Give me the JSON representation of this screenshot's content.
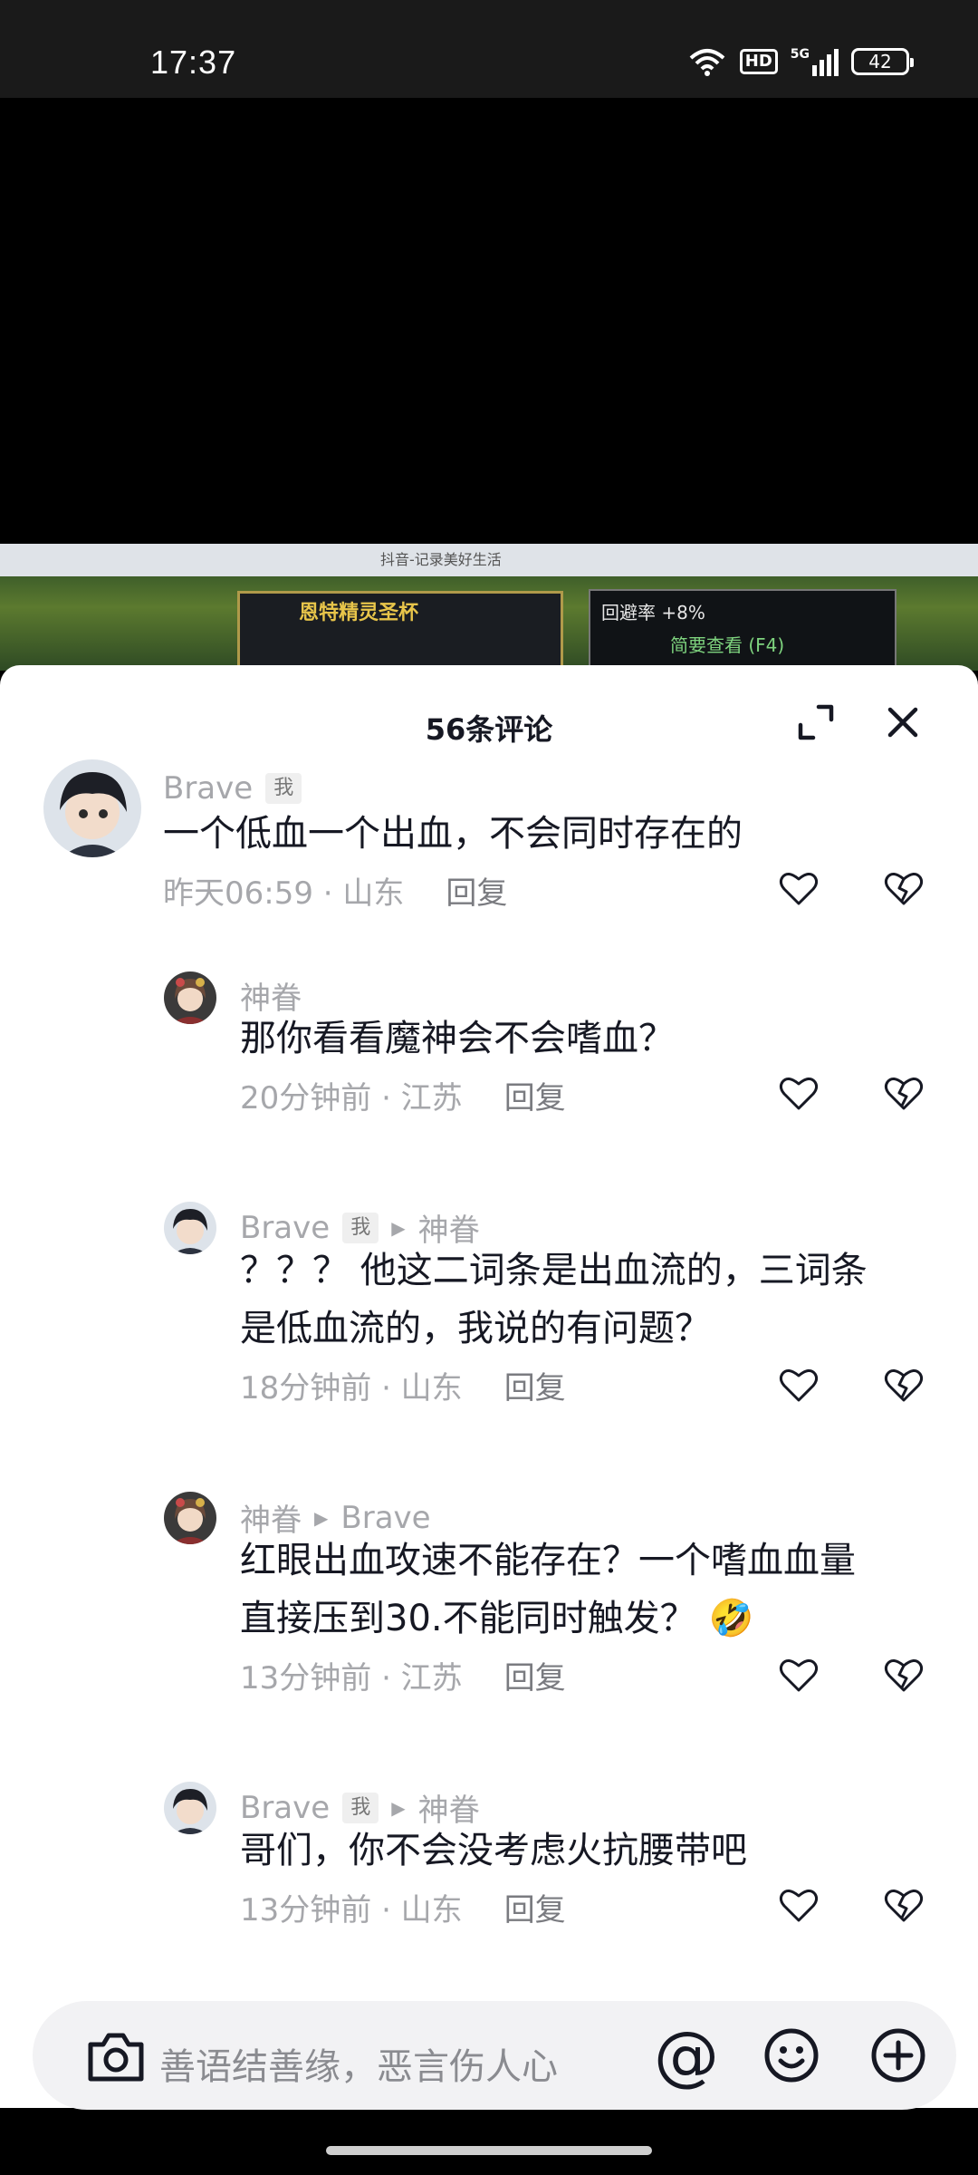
{
  "status": {
    "time": "17:37",
    "network": "5G",
    "hd": "HD",
    "battery": "42"
  },
  "video": {
    "tab_text": "抖音-记录美好生活",
    "game_title": "恩特精灵圣杯",
    "game_stat": "回避率 +8%",
    "game_link": "简要查看 (F4)"
  },
  "sheet": {
    "title": "56条评论"
  },
  "comments": [
    {
      "name": "Brave",
      "badge": "我",
      "text": "一个低血一个出血，不会同时存在的",
      "time_loc": "昨天06:59 · 山东",
      "reply": "回复"
    },
    {
      "name": "神眷",
      "text": "那你看看魔神会不会嗜血？",
      "time_loc": "20分钟前 · 江苏",
      "reply": "回复"
    },
    {
      "name": "Brave",
      "badge": "我",
      "reply_to": "神眷",
      "text_lines": [
        "？？？ 他这二词条是出血流的，三词条",
        "是低血流的，我说的有问题？"
      ],
      "time_loc": "18分钟前 · 山东",
      "reply": "回复"
    },
    {
      "name": "神眷",
      "reply_to": "Brave",
      "text_lines": [
        "红眼出血攻速不能存在？一个嗜血血量",
        "直接压到30.不能同时触发？"
      ],
      "emoji": "🤣",
      "time_loc": "13分钟前 · 江苏",
      "reply": "回复"
    },
    {
      "name": "Brave",
      "badge": "我",
      "reply_to": "神眷",
      "text": "哥们，你不会没考虑火抗腰带吧",
      "time_loc": "13分钟前 · 山东",
      "reply": "回复"
    }
  ],
  "input": {
    "placeholder": "善语结善缘，恶言伤人心",
    "at_symbol": "@"
  },
  "icons": {
    "expand": "expand-icon",
    "close": "close-icon",
    "like": "heart-icon",
    "dislike": "broken-heart-icon",
    "camera": "camera-icon",
    "emoji": "smiley-icon",
    "plus": "plus-icon"
  }
}
